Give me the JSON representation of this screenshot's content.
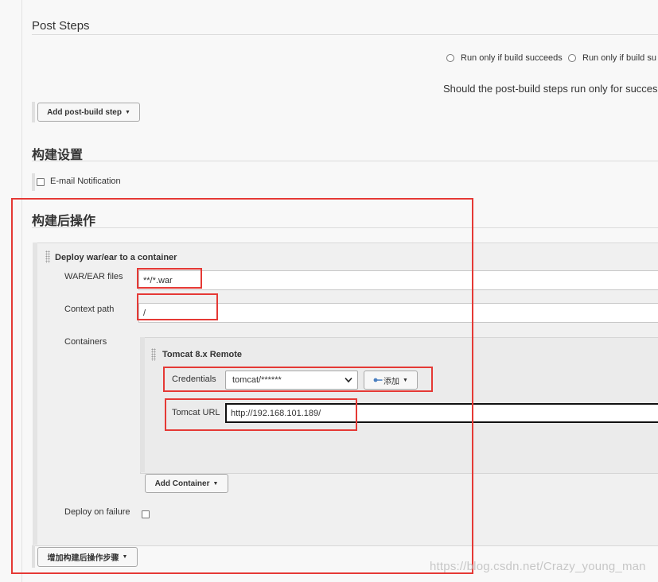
{
  "post_steps": {
    "title": "Post Steps",
    "options": [
      {
        "label": "Run only if build succeeds",
        "selected": false
      },
      {
        "label": "Run only if build su",
        "selected": false
      }
    ],
    "help_text": "Should the post-build steps run only for success",
    "add_button": "Add post-build step"
  },
  "build_settings": {
    "title": "构建设置",
    "email_label": "E-mail Notification",
    "email_checked": false
  },
  "post_build": {
    "title": "构建后操作",
    "deploy": {
      "title": "Deploy war/ear to a container",
      "war_label": "WAR/EAR files",
      "war_value": "**/*.war",
      "context_label": "Context path",
      "context_value": "/",
      "containers_label": "Containers",
      "container": {
        "title": "Tomcat 8.x Remote",
        "credentials_label": "Credentials",
        "credentials_value": "tomcat/******",
        "add_button": "添加",
        "url_label": "Tomcat URL",
        "url_value": "http://192.168.101.189/"
      },
      "add_container_button": "Add Container",
      "deploy_on_failure_label": "Deploy on failure",
      "deploy_on_failure_checked": false
    },
    "add_step_button": "增加构建后操作步骤"
  },
  "watermark": "https://blog.csdn.net/Crazy_young_man"
}
